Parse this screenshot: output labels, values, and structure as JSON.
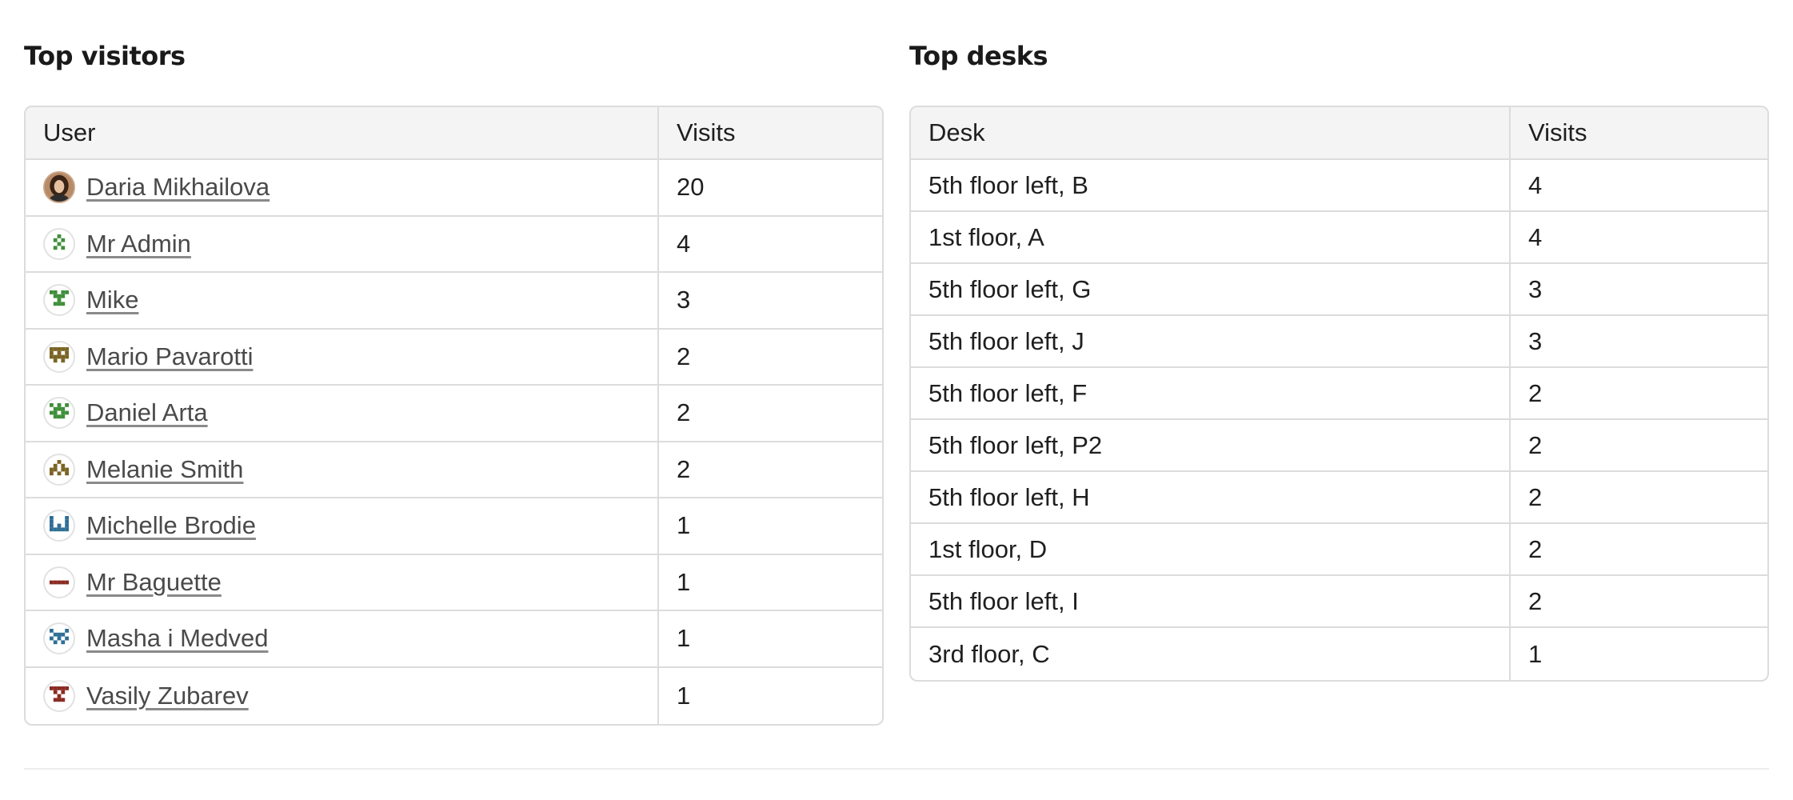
{
  "visitors": {
    "title": "Top visitors",
    "headers": {
      "user": "User",
      "visits": "Visits"
    },
    "rows": [
      {
        "name": "Daria Mikhailova",
        "visits": "20",
        "avatar": "photo-avatar"
      },
      {
        "name": "Mr Admin",
        "visits": "4",
        "avatar": "identicon-avatar",
        "color": "#3f8f3a"
      },
      {
        "name": "Mike",
        "visits": "3",
        "avatar": "identicon-avatar",
        "color": "#3f8f3a"
      },
      {
        "name": "Mario Pavarotti",
        "visits": "2",
        "avatar": "identicon-avatar",
        "color": "#7a6424"
      },
      {
        "name": "Daniel Arta",
        "visits": "2",
        "avatar": "identicon-avatar",
        "color": "#3f8f3a"
      },
      {
        "name": "Melanie Smith",
        "visits": "2",
        "avatar": "identicon-avatar",
        "color": "#7a6424"
      },
      {
        "name": "Michelle Brodie",
        "visits": "1",
        "avatar": "identicon-avatar",
        "color": "#2f6e95"
      },
      {
        "name": "Mr Baguette",
        "visits": "1",
        "avatar": "identicon-avatar",
        "color": "#8a2a22"
      },
      {
        "name": "Masha i Medved",
        "visits": "1",
        "avatar": "identicon-avatar",
        "color": "#2f6e95"
      },
      {
        "name": "Vasily Zubarev",
        "visits": "1",
        "avatar": "identicon-avatar",
        "color": "#8a2a22"
      }
    ]
  },
  "desks": {
    "title": "Top desks",
    "headers": {
      "desk": "Desk",
      "visits": "Visits"
    },
    "rows": [
      {
        "desk": "5th floor left, B",
        "visits": "4"
      },
      {
        "desk": "1st floor, A",
        "visits": "4"
      },
      {
        "desk": "5th floor left, G",
        "visits": "3"
      },
      {
        "desk": "5th floor left, J",
        "visits": "3"
      },
      {
        "desk": "5th floor left, F",
        "visits": "2"
      },
      {
        "desk": "5th floor left, P2",
        "visits": "2"
      },
      {
        "desk": "5th floor left, H",
        "visits": "2"
      },
      {
        "desk": "1st floor, D",
        "visits": "2"
      },
      {
        "desk": "5th floor left, I",
        "visits": "2"
      },
      {
        "desk": "3rd floor, C",
        "visits": "1"
      }
    ]
  }
}
